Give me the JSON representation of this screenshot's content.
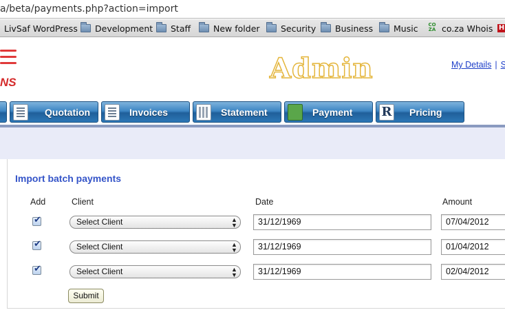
{
  "browser": {
    "url": "/beta/payments.php?action=import",
    "url_shown": "a/beta/payments.php?action=import"
  },
  "bookmarks": [
    {
      "label": "LivSaf WordPress",
      "icon": "none"
    },
    {
      "label": "Development",
      "icon": "folder-icon"
    },
    {
      "label": "Staff",
      "icon": "folder-icon"
    },
    {
      "label": "New folder",
      "icon": "folder-icon"
    },
    {
      "label": "Security",
      "icon": "folder-icon"
    },
    {
      "label": "Business",
      "icon": "folder-icon"
    },
    {
      "label": "Music",
      "icon": "folder-icon"
    },
    {
      "label": "co.za Whois",
      "icon": "coza-icon"
    },
    {
      "label": "H",
      "icon": "red-icon"
    }
  ],
  "header": {
    "logo_text": "NS",
    "title": "Admin",
    "links": [
      "My Details",
      "S"
    ]
  },
  "nav": {
    "tabs": [
      {
        "label": "",
        "icon": "doc-icon"
      },
      {
        "label": "Quotation",
        "icon": "doc-icon"
      },
      {
        "label": "Invoices",
        "icon": "doc-icon"
      },
      {
        "label": "Statement",
        "icon": "calculator-icon"
      },
      {
        "label": "Payment",
        "icon": "money-icon"
      },
      {
        "label": "Pricing",
        "icon": "r-letter-icon"
      }
    ]
  },
  "form": {
    "title": "Import batch payments",
    "columns": {
      "add": "Add",
      "client": "Client",
      "date": "Date",
      "amount": "Amount"
    },
    "rows": [
      {
        "checked": true,
        "client": "Select Client",
        "date": "31/12/1969",
        "amount": "07/04/2012"
      },
      {
        "checked": true,
        "client": "Select Client",
        "date": "31/12/1969",
        "amount": "01/04/2012"
      },
      {
        "checked": true,
        "client": "Select Client",
        "date": "31/12/1969",
        "amount": "02/04/2012"
      }
    ],
    "submit_label": "Submit"
  },
  "colors": {
    "accent": "#3454c8",
    "tab_blue": "#2c77b6",
    "admin_gold": "#e4b53a",
    "logo_red": "#d42a2a"
  }
}
